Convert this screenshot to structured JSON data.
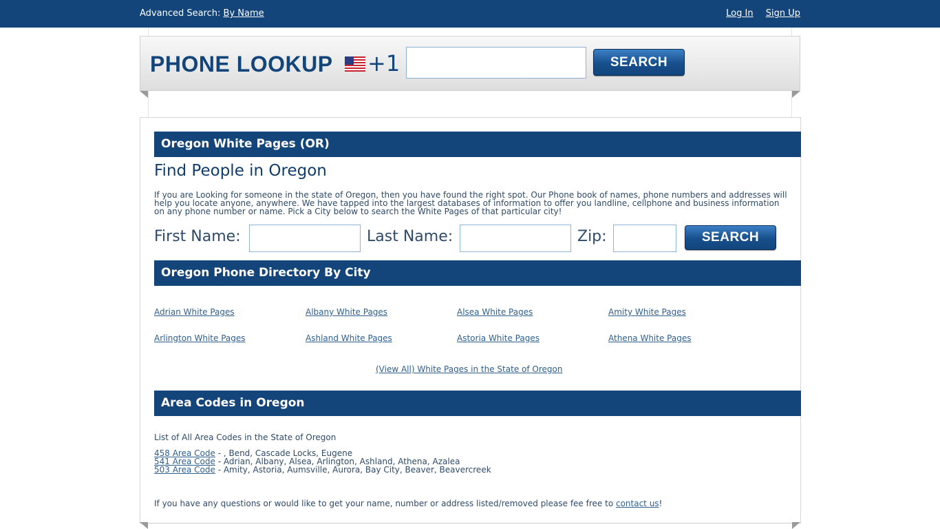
{
  "topbar": {
    "advanced_label": "Advanced Search: ",
    "by_name": "By Name",
    "login": "Log In",
    "signup": "Sign Up"
  },
  "lookup": {
    "brand": "PHONE LOOKUP",
    "country_code": "+1",
    "flag_icon": "us-flag-icon",
    "phone_value": "",
    "search_label": "SEARCH"
  },
  "white_pages": {
    "bar_title": "Oregon White Pages (OR)",
    "heading": "Find People in Oregon",
    "intro": "If you are Looking for someone in the state of Oregon, then you have found the right spot. Our Phone book of names, phone numbers and addresses will help you locate anyone, anywhere. We have tapped into the largest databases of information to offer you landline, cellphone and business information on any phone number or name. Pick a City below to search the White Pages of that particular city!",
    "first_name_label": "First Name:",
    "last_name_label": "Last Name:",
    "zip_label": "Zip:",
    "first_name_value": "",
    "last_name_value": "",
    "zip_value": "",
    "search_label": "SEARCH"
  },
  "directory": {
    "bar_title": "Oregon Phone Directory By City",
    "cities": [
      "Adrian White Pages",
      "Albany White Pages",
      "Alsea White Pages",
      "Amity White Pages",
      "Arlington White Pages",
      "Ashland White Pages",
      "Astoria White Pages",
      "Athena White Pages"
    ],
    "view_all": "(View All) White Pages in the State of Oregon"
  },
  "area_codes": {
    "bar_title": "Area Codes in Oregon",
    "intro": "List of All Area Codes in the State of Oregon",
    "rows": [
      {
        "link": "458 Area Code",
        "text": " - , Bend, Cascade Locks, Eugene"
      },
      {
        "link": "541 Area Code",
        "text": " - Adrian, Albany, Alsea, Arlington, Ashland, Athena, Azalea"
      },
      {
        "link": "503 Area Code",
        "text": " - Amity, Astoria, Aumsville, Aurora, Bay City, Beaver, Beavercreek"
      }
    ]
  },
  "footer": {
    "text_before": "If you have any questions or would like to get your name, number or address listed/removed please fee free to ",
    "contact_link": "contact us",
    "text_after": "!"
  },
  "colors": {
    "brand_blue": "#13457a",
    "link_blue": "#2e5f8f",
    "panel_gray": "#dedede"
  }
}
